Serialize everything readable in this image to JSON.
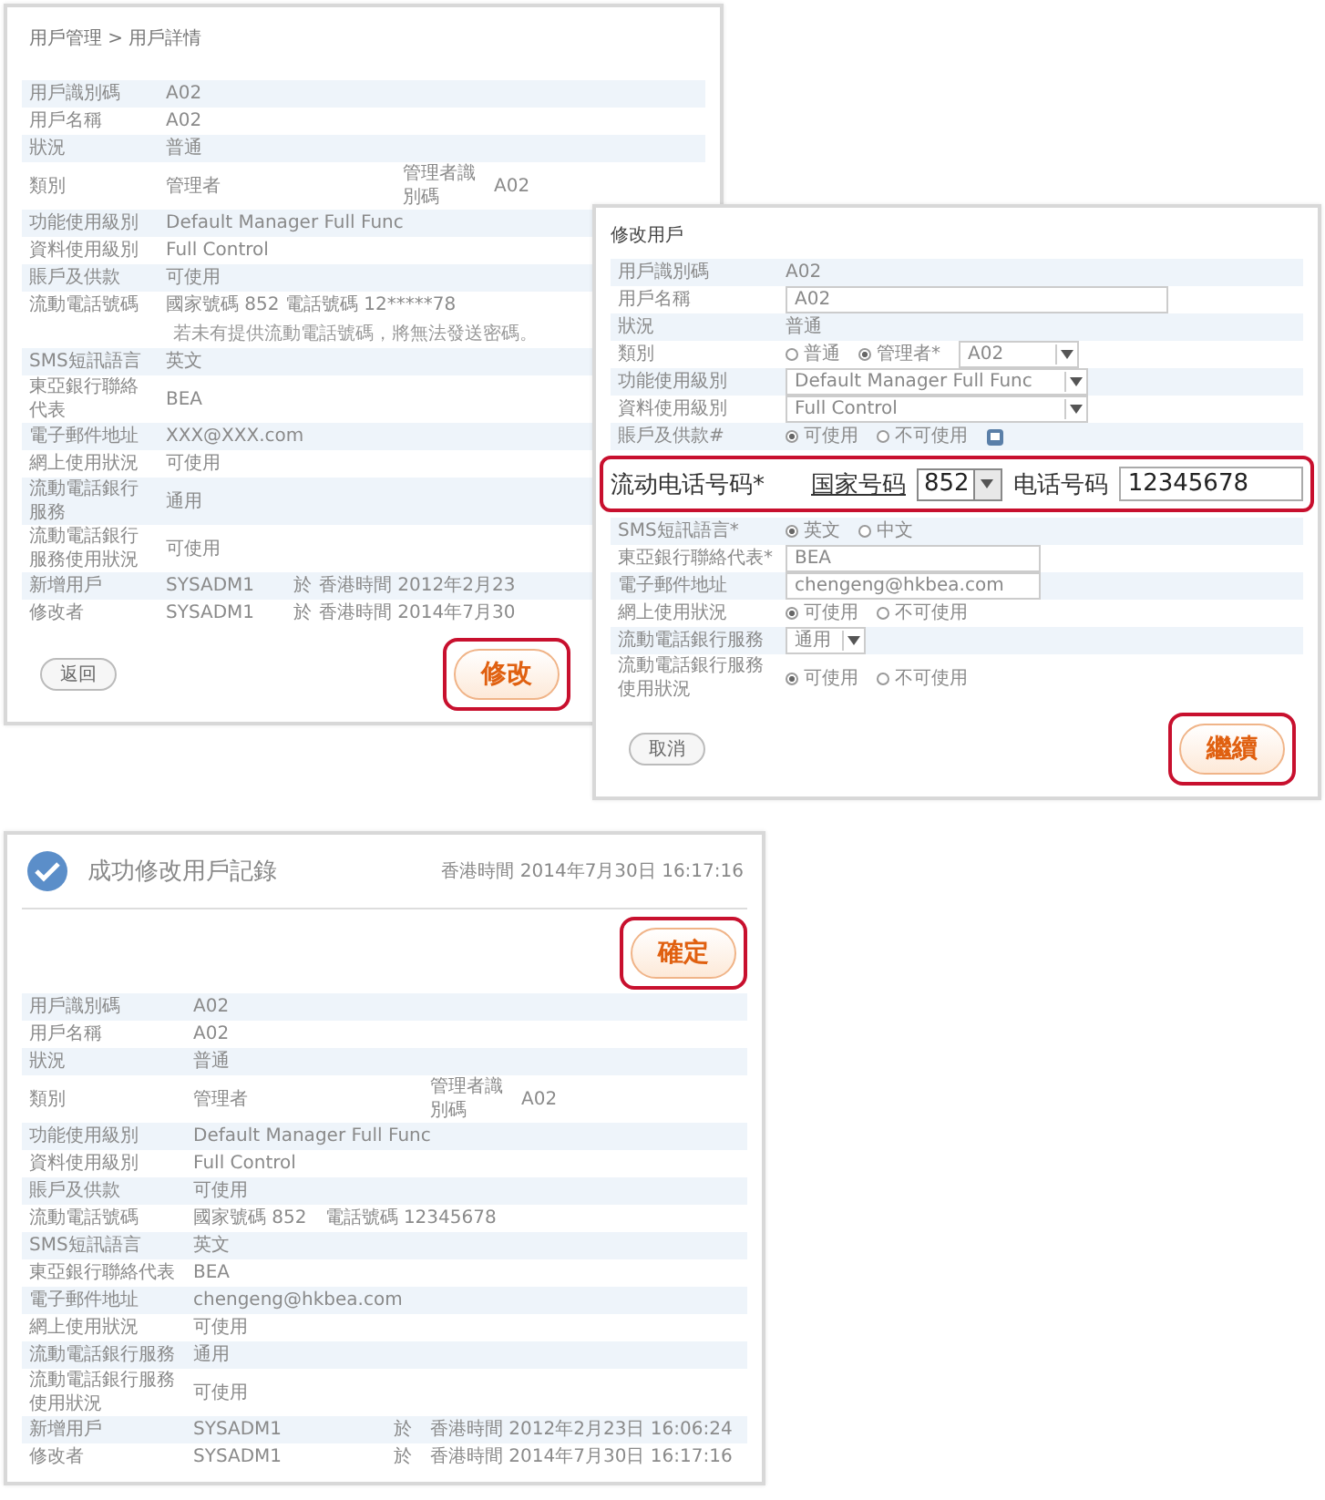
{
  "detail_panel": {
    "breadcrumb": "用戶管理 > 用戶詳情",
    "rows": [
      {
        "kind": "plain",
        "label": "用戶識別碼",
        "value": "A02"
      },
      {
        "kind": "plain",
        "label": "用戶名稱",
        "value": "A02"
      },
      {
        "kind": "plain",
        "label": "狀況",
        "value": "普通"
      },
      {
        "kind": "pair",
        "label": "類別",
        "value": "管理者",
        "sub_label": "管理者識別碼",
        "sub_value": "A02"
      },
      {
        "kind": "plain",
        "label": "功能使用級別",
        "value": "Default Manager Full Func"
      },
      {
        "kind": "plain",
        "label": "資料使用級別",
        "value": "Full Control"
      },
      {
        "kind": "plain",
        "label": "賬戶及供款",
        "value": "可使用"
      },
      {
        "kind": "phone",
        "label": "流動電話號碼",
        "value": "國家號碼 852 電話號碼 12*****78",
        "note": "若未有提供流動電話號碼，將無法發送密碼。"
      },
      {
        "kind": "plain",
        "label": "SMS短訊語言",
        "value": "英文"
      },
      {
        "kind": "plain",
        "label": "東亞銀行聯絡代表",
        "value": "BEA"
      },
      {
        "kind": "plain",
        "label": "電子郵件地址",
        "value": "XXX@XXX.com"
      },
      {
        "kind": "plain",
        "label": "網上使用狀況",
        "value": "可使用"
      },
      {
        "kind": "plain",
        "label": "流動電話銀行服務",
        "value": "通用"
      },
      {
        "kind": "plain",
        "label": "流動電話銀行服務使用狀況",
        "value": "可使用"
      },
      {
        "kind": "audit",
        "label": "新增用戶",
        "user": "SYSADM1",
        "at": "於",
        "time": "香港時間 2012年2月23"
      },
      {
        "kind": "audit",
        "label": "修改者",
        "user": "SYSADM1",
        "at": "於",
        "time": "香港時間 2014年7月30"
      }
    ],
    "back_button": {
      "label": "返回",
      "highlighted": false
    },
    "edit_button": {
      "label": "修改",
      "highlighted": true
    }
  },
  "edit_panel": {
    "title": "修改用戶",
    "rows": [
      {
        "kind": "static",
        "label": "用戶識別碼",
        "value": "A02"
      },
      {
        "kind": "input",
        "label": "用戶名稱",
        "value": "A02"
      },
      {
        "kind": "static",
        "label": "狀況",
        "value": "普通"
      },
      {
        "kind": "radio",
        "label": "類別",
        "options": [
          {
            "label": "普通",
            "selected": false
          },
          {
            "label": "管理者*",
            "selected": true
          }
        ],
        "select": "A02"
      },
      {
        "kind": "select",
        "label": "功能使用級別",
        "value": "Default Manager Full Func"
      },
      {
        "kind": "select",
        "label": "資料使用級別",
        "value": "Full Control"
      },
      {
        "kind": "radio",
        "label": "賬戶及供款#",
        "options": [
          {
            "label": "可使用",
            "selected": true
          },
          {
            "label": "不可使用",
            "selected": false
          }
        ],
        "info": true
      },
      {
        "kind": "phone",
        "label": "流动电话号码*",
        "country_label": "国家号码",
        "country_code": "852",
        "phone_label": "电话号码",
        "phone": "12345678",
        "highlighted": true
      },
      {
        "kind": "radio",
        "label": "SMS短訊語言*",
        "options": [
          {
            "label": "英文",
            "selected": true
          },
          {
            "label": "中文",
            "selected": false
          }
        ]
      },
      {
        "kind": "input",
        "label": "東亞銀行聯絡代表*",
        "value": "BEA"
      },
      {
        "kind": "input",
        "label": "電子郵件地址",
        "value": "chengeng@hkbea.com"
      },
      {
        "kind": "radio",
        "label": "網上使用狀況",
        "options": [
          {
            "label": "可使用",
            "selected": true
          },
          {
            "label": "不可使用",
            "selected": false
          }
        ]
      },
      {
        "kind": "select",
        "label": "流動電話銀行服務",
        "value": "通用"
      },
      {
        "kind": "radio",
        "label": "流動電話銀行服務使用狀況",
        "options": [
          {
            "label": "可使用",
            "selected": true
          },
          {
            "label": "不可使用",
            "selected": false
          }
        ]
      }
    ],
    "cancel_button": {
      "label": "取消",
      "highlighted": false
    },
    "continue_button": {
      "label": "繼續",
      "highlighted": true
    }
  },
  "success_panel": {
    "message": "成功修改用戶記錄",
    "timestamp": "香港時間 2014年7月30日 16:17:16",
    "confirm_button": {
      "label": "確定",
      "highlighted": true
    },
    "rows": [
      {
        "kind": "plain",
        "label": "用戶識別碼",
        "value": "A02"
      },
      {
        "kind": "plain",
        "label": "用戶名稱",
        "value": "A02"
      },
      {
        "kind": "plain",
        "label": "狀況",
        "value": "普通"
      },
      {
        "kind": "pair",
        "label": "類別",
        "value": "管理者",
        "sub_label": "管理者識別碼",
        "sub_value": "A02"
      },
      {
        "kind": "plain",
        "label": "功能使用級別",
        "value": "Default Manager Full Func"
      },
      {
        "kind": "plain",
        "label": "資料使用級別",
        "value": "Full Control"
      },
      {
        "kind": "plain",
        "label": "賬戶及供款",
        "value": "可使用"
      },
      {
        "kind": "plain",
        "label": "流動電話號碼",
        "value": "國家號碼 852　電話號碼 12345678"
      },
      {
        "kind": "plain",
        "label": "SMS短訊語言",
        "value": "英文"
      },
      {
        "kind": "plain",
        "label": "東亞銀行聯絡代表",
        "value": "BEA"
      },
      {
        "kind": "plain",
        "label": "電子郵件地址",
        "value": "chengeng@hkbea.com"
      },
      {
        "kind": "plain",
        "label": "網上使用狀況",
        "value": "可使用"
      },
      {
        "kind": "plain",
        "label": "流動電話銀行服務",
        "value": "通用"
      },
      {
        "kind": "plain",
        "label": "流動電話銀行服務使用狀況",
        "value": "可使用"
      },
      {
        "kind": "audit",
        "label": "新增用戶",
        "user": "SYSADM1",
        "at": "於",
        "time": "香港時間 2012年2月23日 16:06:24"
      },
      {
        "kind": "audit",
        "label": "修改者",
        "user": "SYSADM1",
        "at": "於",
        "time": "香港時間 2014年7月30日 16:17:16"
      }
    ]
  }
}
